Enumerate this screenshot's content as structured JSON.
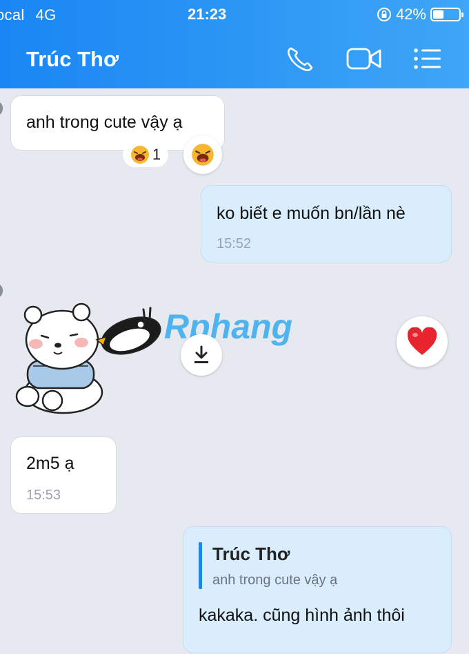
{
  "status_bar": {
    "carrier": "ocal",
    "network": "4G",
    "time": "21:23",
    "battery": "42%",
    "battery_level": 0.42
  },
  "header": {
    "contact_name": "Trúc Thơ",
    "icons": [
      "phone-icon",
      "video-call-icon",
      "menu-list-icon"
    ]
  },
  "messages": [
    {
      "side": "incoming",
      "text": "anh trong cute vậy ạ",
      "reaction": {
        "emoji": "laughing-face",
        "count": "1"
      }
    },
    {
      "side": "outgoing",
      "text": "ko biết e muốn bn/lần nè",
      "time": "15:52"
    },
    {
      "side": "incoming",
      "type": "sticker",
      "sticker": "bear-and-penguin-sticker",
      "reaction": "heart"
    },
    {
      "side": "incoming",
      "text": "2m5 ạ",
      "time": "15:53"
    },
    {
      "side": "outgoing",
      "reply_to": {
        "name": "Trúc Thơ",
        "text": "anh trong cute vậy ạ"
      },
      "text": "kakaka. cũng hình ảnh thôi"
    }
  ],
  "watermark": "Rphang",
  "colors": {
    "header_start": "#1a86f3",
    "header_end": "#3ea6f6",
    "outgoing_bubble": "#d9edfd",
    "chat_bg": "#e6e9f0",
    "reply_bar": "#1a86f3",
    "heart": "#e8252e"
  }
}
